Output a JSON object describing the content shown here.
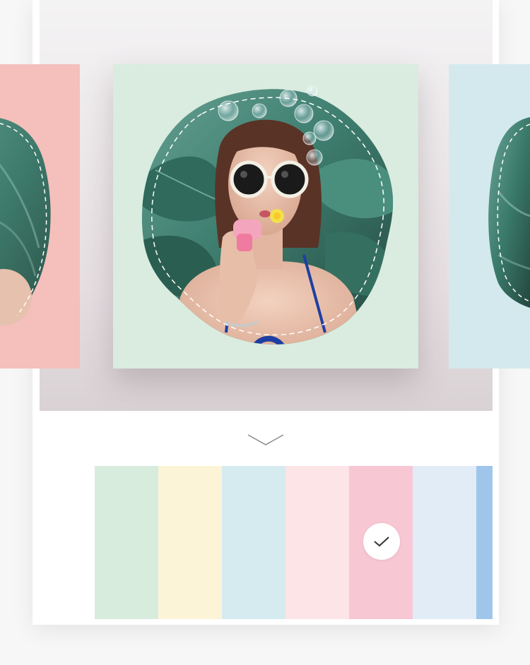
{
  "colors": {
    "card_left": "#f5bfbc",
    "card_center": "#d9ecdf",
    "card_right": "#d3e9ee"
  },
  "icons": {
    "expand": "chevron-down-icon",
    "selected": "checkmark-icon"
  },
  "palette": {
    "swatches": [
      {
        "color": "#d7ecdd",
        "selected": false
      },
      {
        "color": "#fcf4d7",
        "selected": false
      },
      {
        "color": "#d5ebef",
        "selected": false
      },
      {
        "color": "#fde4e6",
        "selected": false
      },
      {
        "color": "#f8c7d4",
        "selected": true
      },
      {
        "color": "#e1ecf7",
        "selected": false
      },
      {
        "color": "#9fc6ea",
        "selected": false
      }
    ]
  }
}
